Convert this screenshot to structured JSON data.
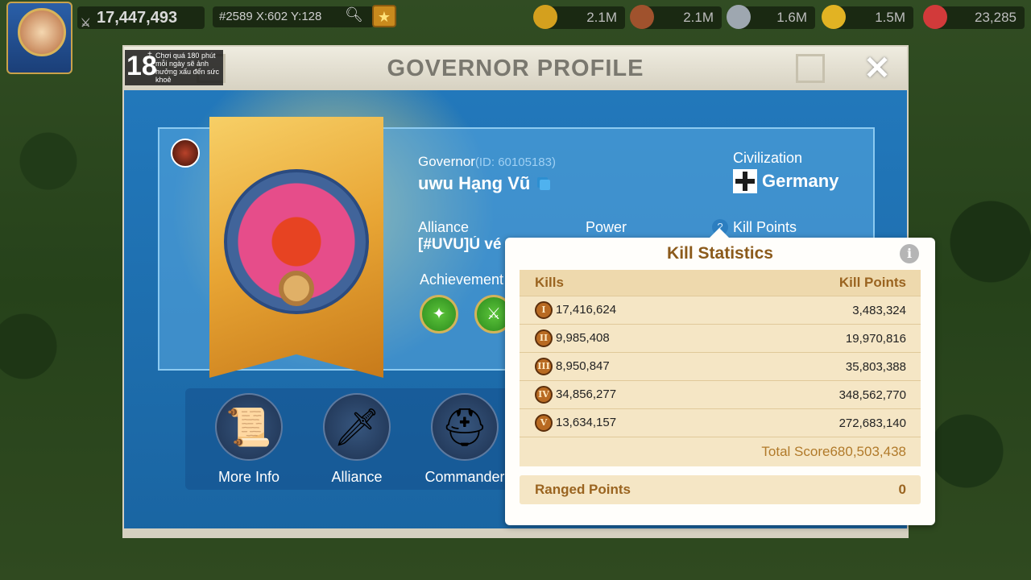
{
  "hud": {
    "power": "17,447,493",
    "coords": "#2589 X:602 Y:128",
    "resources": [
      {
        "name": "food",
        "value": "2.1M",
        "color": "#d4a01e"
      },
      {
        "name": "wood",
        "value": "2.1M",
        "color": "#a0522d"
      },
      {
        "name": "stone",
        "value": "1.6M",
        "color": "#9ea7b0"
      },
      {
        "name": "gold",
        "value": "1.5M",
        "color": "#e2b323"
      },
      {
        "name": "gems",
        "value": "23,285",
        "color": "#d23a3a"
      }
    ]
  },
  "age_notice": {
    "rating": "18",
    "plus": "+",
    "text": "Chơi quá 180 phút mỗi ngày sẽ ảnh hưởng xấu đến sức khoẻ"
  },
  "modal": {
    "title": "GOVERNOR PROFILE",
    "close_label": "✕",
    "governor_label": "Governor",
    "governor_id": "(ID: 60105183)",
    "governor_name": "uwu Hạng Vũ",
    "civilization_label": "Civilization",
    "civilization": "Germany",
    "alliance_label": "Alliance",
    "alliance_value": "[#UVU]Ủ vé",
    "power_label": "Power",
    "kill_points_label": "Kill Points",
    "achievement_label": "Achievement",
    "buttons": [
      {
        "label": "More Info",
        "icon": "scroll-icon"
      },
      {
        "label": "Alliance",
        "icon": "sword-icon"
      },
      {
        "label": "Commander",
        "icon": "helmet-icon"
      }
    ]
  },
  "kill_stats": {
    "title": "Kill Statistics",
    "info_label": "i",
    "col_kills": "Kills",
    "col_points": "Kill Points",
    "rows": [
      {
        "tier": "I",
        "kills": "17,416,624",
        "points": "3,483,324"
      },
      {
        "tier": "II",
        "kills": "9,985,408",
        "points": "19,970,816"
      },
      {
        "tier": "III",
        "kills": "8,950,847",
        "points": "35,803,388"
      },
      {
        "tier": "IV",
        "kills": "34,856,277",
        "points": "348,562,770"
      },
      {
        "tier": "V",
        "kills": "13,634,157",
        "points": "272,683,140"
      }
    ],
    "total_label": "Total Score",
    "total_value": "680,503,438",
    "ranged_label": "Ranged Points",
    "ranged_value": "0"
  }
}
